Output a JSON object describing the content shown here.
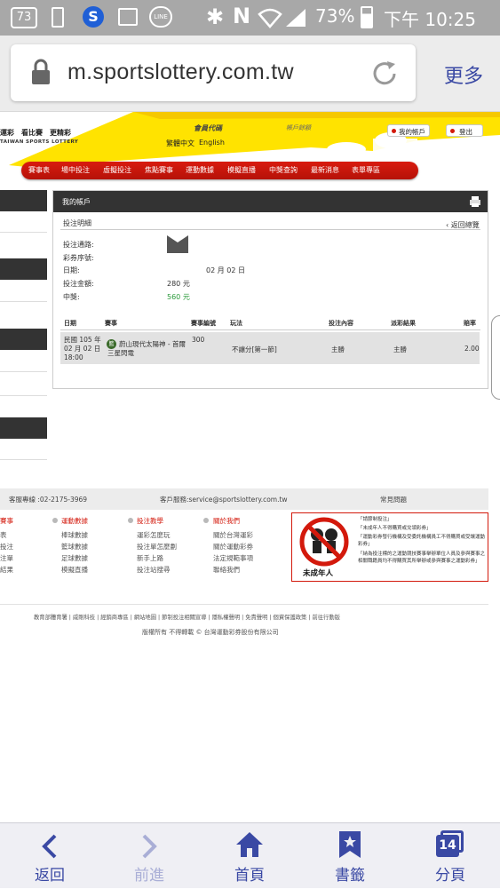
{
  "statusbar": {
    "sim": "73",
    "battery": "73%",
    "time": "下午 10:25"
  },
  "browser": {
    "url": "m.sportslottery.com.tw",
    "more_label": "更多"
  },
  "site_header": {
    "brand_links": "運彩　看比賽　更精彩",
    "brand_english": "TAIWAN SPORTS LOTTERY",
    "member_code_label": "會員代碼",
    "account_no_label": "帳戶餘額",
    "lang_zh": "繁體中文",
    "lang_en": "English",
    "my_account_button": "我的帳戶",
    "logout_button": "登出"
  },
  "nav": {
    "items": [
      "賽事表",
      "場中投注",
      "虛擬投注",
      "焦點賽事",
      "運動數據",
      "模擬直播",
      "中獎查詢",
      "最新消息",
      "表單專區"
    ]
  },
  "panel": {
    "title": "我的帳戶",
    "subtitle": "投注明細",
    "back_link": "返回總覽",
    "fields": {
      "channel_label": "投注通路:",
      "serial_label": "彩券序號:",
      "date_label": "日期:",
      "date_value": "02 月 02 日",
      "amount_label": "投注金額:",
      "amount_value": "280 元",
      "prize_label": "中獎:",
      "prize_value": "560 元"
    },
    "table": {
      "headers": [
        "日期",
        "賽事",
        "賽事編號",
        "玩法",
        "投注內容",
        "派彩結果",
        "賠率"
      ],
      "row": {
        "date": "民國 105 年 02 月 02 日 18:00",
        "event": "蔚山現代太陽神 - 首爾三星閃電",
        "event_no": "300",
        "play": "不讓分[第一節]",
        "content": "主勝",
        "result": "主勝",
        "odds": "2.00"
      }
    }
  },
  "footer": {
    "hotline": "客服專線 :02-2175-3969",
    "service": "客戶服務:service@sportslottery.com.tw",
    "faq": "常見問題",
    "col1": [
      "賽事",
      "表",
      "投注",
      "注單",
      "結果"
    ],
    "col2_title": "運動數據",
    "col2": [
      "棒球數據",
      "籃球數據",
      "足球數據",
      "模擬直播"
    ],
    "col3_title": "投注教學",
    "col3": [
      "運彩怎麼玩",
      "投注單怎麼劃",
      "新手上路",
      "投注站搜尋"
    ],
    "col4_title": "關於我們",
    "col4": [
      "關於台灣運彩",
      "關於運動彩券",
      "法定規範事項",
      "聯絡我們"
    ],
    "notice_sign": "未成年人",
    "notices": [
      "「請節制投注」",
      "「未成年人不得購買或兌領彩券」",
      "「運動彩券發行機構及受委託機構員工不得購買或受讓運動彩券」",
      "「納為投注標的之運動競技賽事舉辦單位人員及參與賽事之相關職籍員均不得購買其所舉辦或參與賽事之運動彩券」"
    ],
    "bottom_links": "教育部體育署 | 威剛科技 | 經銷商專區 | 網站地圖 | 節制投注相關宣導 | 隱私權聲明 | 免責聲明 | 個資保護政策 | 前往行動版",
    "copyright": "版權所有 不得轉載 © 台灣運動彩券股份有限公司"
  },
  "bottomnav": {
    "back": "返回",
    "forward": "前進",
    "home": "首頁",
    "bookmarks": "書籤",
    "tabs": "分頁",
    "tab_count": "14"
  },
  "colors": {
    "accent_blue": "#3a49a4",
    "brand_yellow": "#ffe300",
    "nav_red": "#d3190c",
    "dark_bar": "#333333",
    "prize_green": "#2a9a3a"
  }
}
